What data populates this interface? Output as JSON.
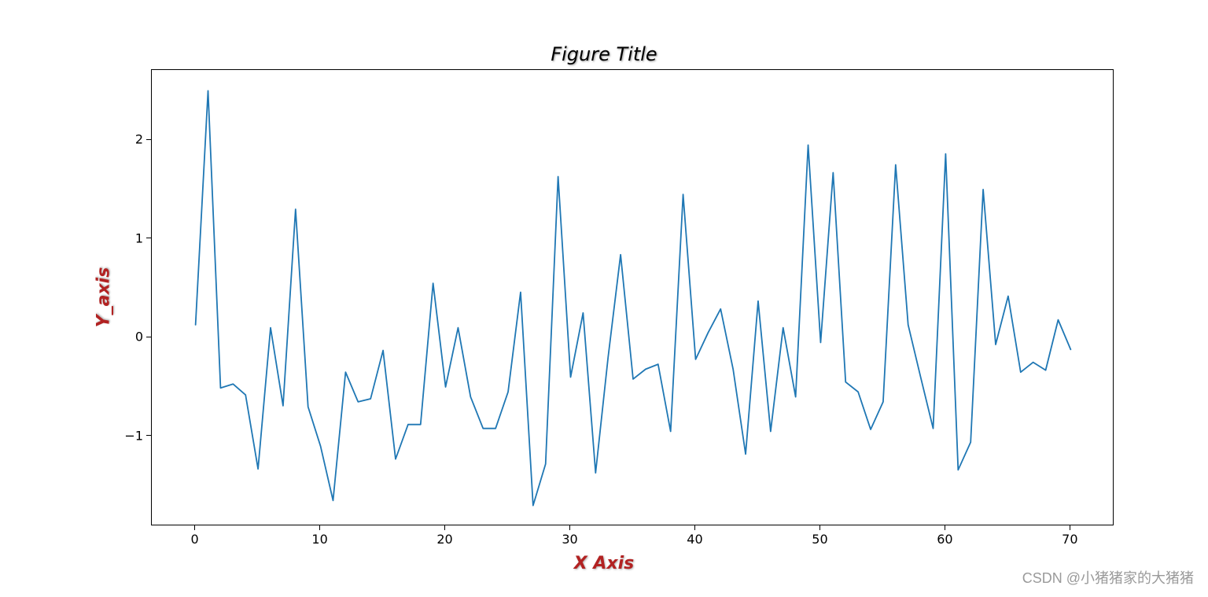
{
  "chart_data": {
    "type": "line",
    "title": "Figure Title",
    "xlabel": "X Axis",
    "ylabel": "Y_axis",
    "xlim": [
      -3.5,
      73.5
    ],
    "ylim": [
      -1.91,
      2.71
    ],
    "xticks": [
      0,
      10,
      20,
      30,
      40,
      50,
      60,
      70
    ],
    "yticks": [
      -1,
      0,
      1,
      2
    ],
    "x": [
      0,
      1,
      2,
      3,
      4,
      5,
      6,
      7,
      8,
      9,
      10,
      11,
      12,
      13,
      14,
      15,
      16,
      17,
      18,
      19,
      20,
      21,
      22,
      23,
      24,
      25,
      26,
      27,
      28,
      29,
      30,
      31,
      32,
      33,
      34,
      35,
      36,
      37,
      38,
      39,
      40,
      41,
      42,
      43,
      44,
      45,
      46,
      47,
      48,
      49,
      50,
      51,
      52,
      53,
      54,
      55,
      56,
      57,
      58,
      59,
      60,
      61,
      62,
      63,
      64,
      65,
      66,
      67,
      68,
      69,
      70
    ],
    "values": [
      0.13,
      2.5,
      -0.51,
      -0.47,
      -0.58,
      -1.33,
      0.1,
      -0.69,
      1.3,
      -0.7,
      -1.1,
      -1.65,
      -0.35,
      -0.65,
      -0.62,
      -0.13,
      -1.23,
      -0.88,
      -0.88,
      0.55,
      -0.5,
      0.1,
      -0.6,
      -0.92,
      -0.92,
      -0.55,
      0.46,
      -1.7,
      -1.28,
      1.63,
      -0.4,
      0.25,
      -1.37,
      -0.2,
      0.84,
      -0.42,
      -0.32,
      -0.27,
      -0.95,
      1.45,
      -0.22,
      0.05,
      0.29,
      -0.32,
      -1.18,
      0.37,
      -0.95,
      0.1,
      -0.6,
      1.95,
      -0.05,
      1.67,
      -0.45,
      -0.55,
      -0.93,
      -0.65,
      1.75,
      0.13,
      -0.4,
      -0.92,
      1.86,
      -1.34,
      -1.06,
      1.5,
      -0.07,
      0.42,
      -0.35,
      -0.25,
      -0.33,
      0.18,
      -0.12
    ],
    "line_color": "#1f77b4"
  },
  "watermark": "CSDN @小猪猪家的大猪猪"
}
